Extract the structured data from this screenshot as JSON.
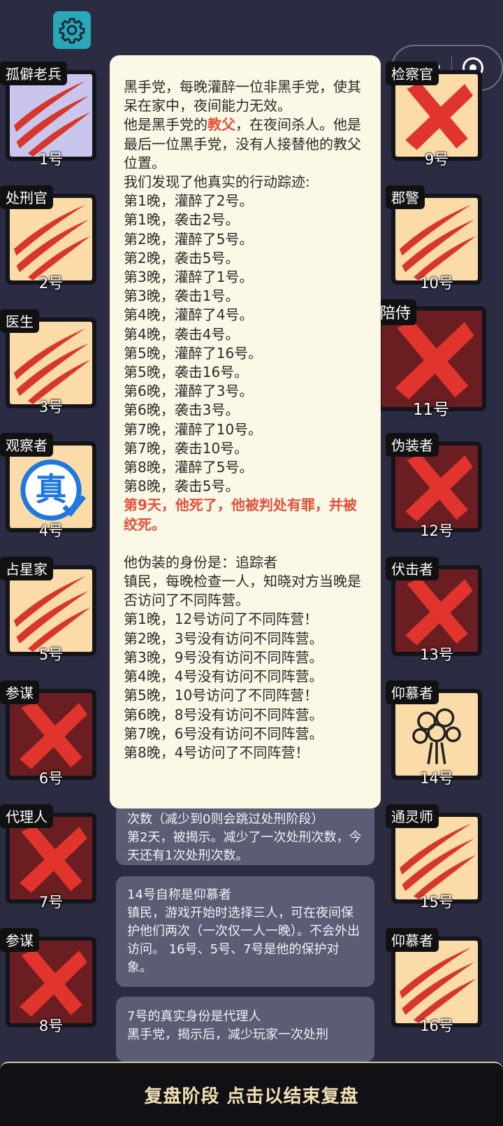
{
  "header": {
    "settings_icon": "gear-icon"
  },
  "capsule": {
    "menu_icon": "more-dots-icon",
    "close_icon": "record-circle-icon"
  },
  "players_left": [
    {
      "role": "孤僻老兵",
      "num": "1号",
      "state": "slashed",
      "bg": "#c8c6ec"
    },
    {
      "role": "处刑官",
      "num": "2号",
      "state": "slashed",
      "bg": "#fbdca8"
    },
    {
      "role": "医生",
      "num": "3号",
      "state": "slashed",
      "bg": "#fbdca8"
    },
    {
      "role": "观察者",
      "num": "4号",
      "state": "alive-true",
      "bg": "#fbdca8",
      "badge": "真"
    },
    {
      "role": "占星家",
      "num": "5号",
      "state": "slashed",
      "bg": "#fbdca8"
    },
    {
      "role": "参谋",
      "num": "6号",
      "state": "crossed",
      "bg": "#6a1e22"
    },
    {
      "role": "代理人",
      "num": "7号",
      "state": "crossed",
      "bg": "#6a1e22"
    },
    {
      "role": "参谋",
      "num": "8号",
      "state": "crossed",
      "bg": "#6a1e22"
    }
  ],
  "players_right": [
    {
      "role": "检察官",
      "num": "9号",
      "state": "crossed",
      "bg": "#fbdca8"
    },
    {
      "role": "郡警",
      "num": "10号",
      "state": "slashed",
      "bg": "#fbdca8"
    },
    {
      "role": "陪侍",
      "num": "11号",
      "state": "crossed",
      "bg": "#6a1e22"
    },
    {
      "role": "伪装者",
      "num": "12号",
      "state": "crossed",
      "bg": "#6a1e22"
    },
    {
      "role": "伏击者",
      "num": "13号",
      "state": "crossed",
      "bg": "#6a1e22"
    },
    {
      "role": "仰慕者",
      "num": "14号",
      "state": "alive",
      "bg": "#fbdca8"
    },
    {
      "role": "通灵师",
      "num": "15号",
      "state": "slashed",
      "bg": "#fbdca8"
    },
    {
      "role": "仰慕者",
      "num": "16号",
      "state": "slashed",
      "bg": "#fbdca8"
    }
  ],
  "popup": {
    "intro": "黑手党，每晚灌醉一位非黑手党，使其呆在家中，夜间能力无效。",
    "line2_a": "他是黑手党的",
    "line2_hl": "教父",
    "line2_b": "，在夜间杀人。他是最后一位黑手党，没有人接替他的教父位置。",
    "trace_title": "我们发现了他真实的行动踪迹:",
    "actions": [
      "第1晚，灌醉了2号。",
      "第1晚，袭击2号。",
      "第2晚，灌醉了5号。",
      "第2晚，袭击5号。",
      "第3晚，灌醉了1号。",
      "第3晚，袭击1号。",
      "第4晚，灌醉了4号。",
      "第4晚，袭击4号。",
      "第5晚，灌醉了16号。",
      "第5晚，袭击16号。",
      "第6晚，灌醉了3号。",
      "第6晚，袭击3号。",
      "第7晚，灌醉了10号。",
      "第7晚，袭击10号。",
      "第8晚，灌醉了5号。",
      "第8晚，袭击5号。"
    ],
    "death": "第9天，他死了，他被判处有罪，并被绞死。",
    "disguise": "他伪装的身份是：追踪者",
    "disguise_desc": "镇民，每晚检查一人，知晓对方当晚是否访问了不同阵营。",
    "checks": [
      "第1晚，12号访问了不同阵营！",
      "第2晚，3号没有访问不同阵营。",
      "第3晚，9号没有访问不同阵营。",
      "第4晚，4号没有访问不同阵营。",
      "第5晚，10号访问了不同阵营！",
      "第6晚，8号没有访问不同阵营。",
      "第7晚，6号没有访问不同阵营。",
      "第8晚，4号访问了不同阵营！"
    ]
  },
  "log": [
    {
      "text": "次数（减少到0则会跳过处刑阶段）\n第2天，被揭示。减少了一次处刑次数，今天还有1次处刑次数。"
    },
    {
      "text": "14号自称是仰慕者\n镇民，游戏开始时选择三人，可在夜间保护他们两次（一次仅一人一晚）。不会外出访问。 16号、5号、7号是他的保护对象。"
    },
    {
      "text": "7号的真实身份是代理人\n黑手党，揭示后，减少玩家一次处刑"
    }
  ],
  "footer": {
    "label": "复盘阶段 点击以结束复盘"
  }
}
